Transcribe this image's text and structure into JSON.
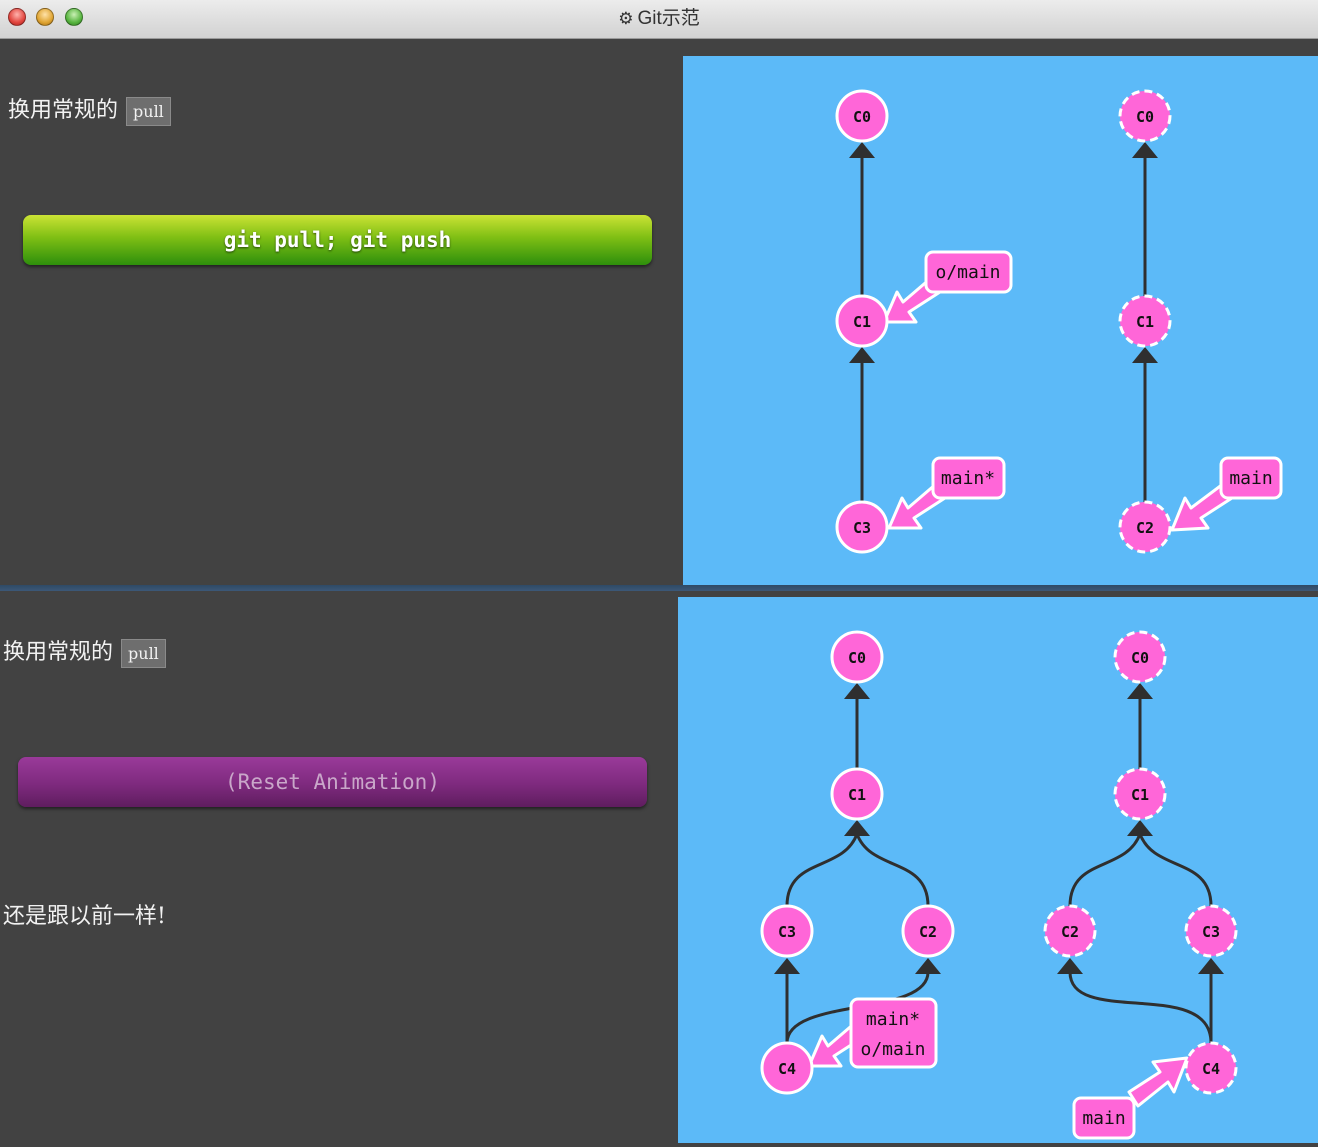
{
  "window": {
    "title": "Git示范"
  },
  "panel1": {
    "headline": "换用常规的",
    "code": "pull",
    "command_button": "git pull; git push",
    "local_tree": {
      "commits": [
        "C0",
        "C1",
        "C3"
      ],
      "branches": [
        "o/main",
        "main*"
      ]
    },
    "remote_tree": {
      "commits": [
        "C0",
        "C1",
        "C2"
      ],
      "branches": [
        "main"
      ]
    }
  },
  "panel2": {
    "headline": "换用常规的",
    "code": "pull",
    "command_button": "(Reset Animation)",
    "paragraph": "还是跟以前一样!",
    "local_tree": {
      "commits": [
        "C0",
        "C1",
        "C3",
        "C2",
        "C4"
      ],
      "branches": [
        "main*",
        "o/main"
      ]
    },
    "remote_tree": {
      "commits": [
        "C0",
        "C1",
        "C2",
        "C3",
        "C4"
      ],
      "branches": [
        "main"
      ]
    }
  },
  "colors": {
    "visualization_bg": "#5cbaf8",
    "commit_fill": "#ff66d8",
    "edge": "#2f2f2f"
  }
}
